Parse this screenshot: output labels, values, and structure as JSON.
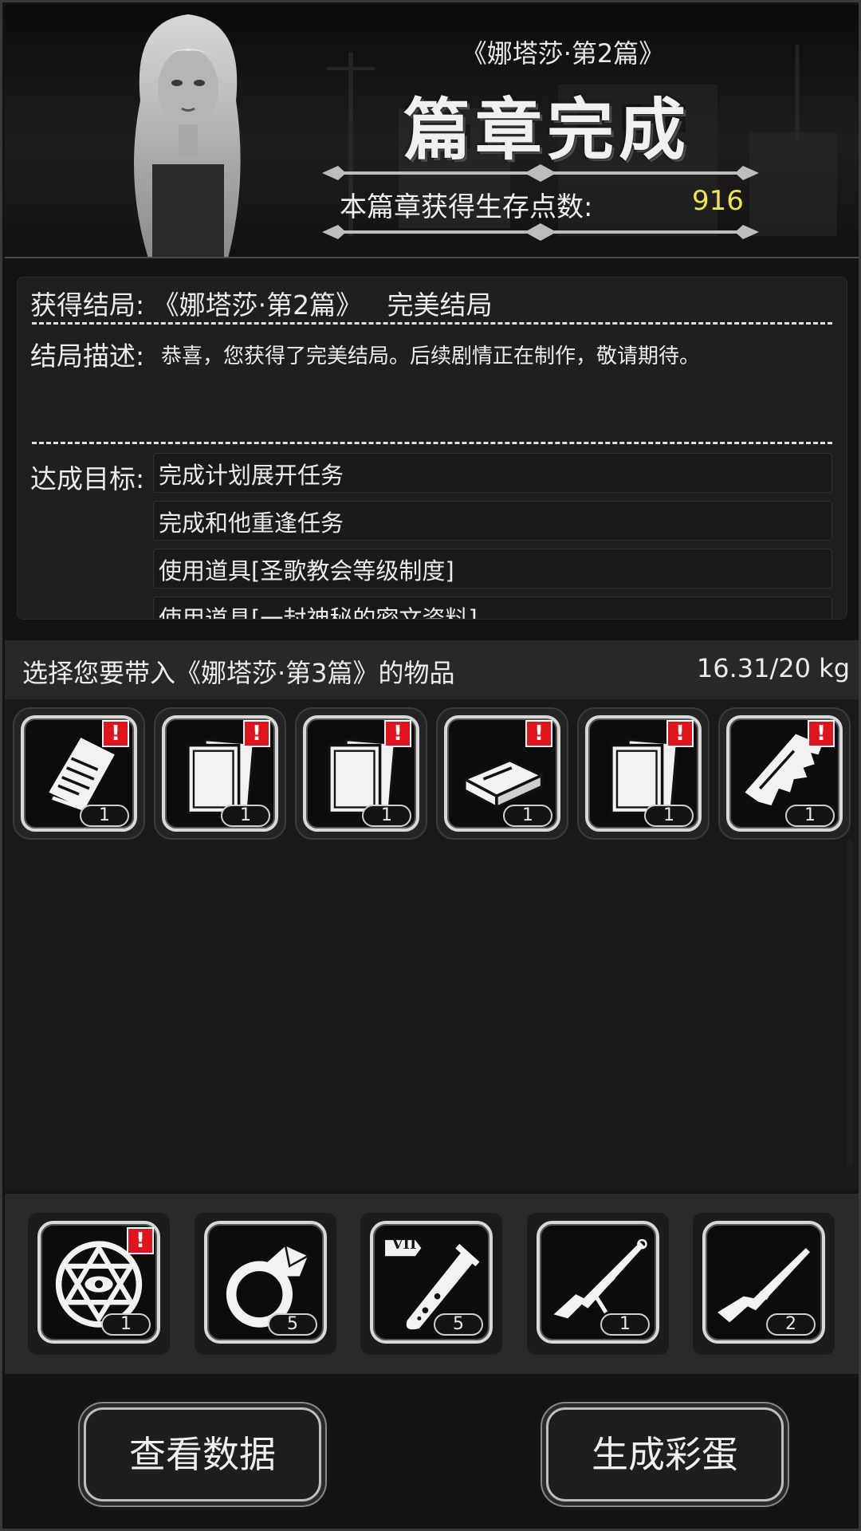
{
  "header": {
    "chapter_name": "《娜塔莎·第2篇》",
    "title": "篇章完成",
    "points_label": "本篇章获得生存点数:",
    "points_value": "916"
  },
  "ending": {
    "title_label": "获得结局:",
    "title_value": "《娜塔莎·第2篇》   完美结局",
    "desc_label": "结局描述:",
    "desc_text": "恭喜，您获得了完美结局。后续剧情正在制作，敬请期待。",
    "goals_label": "达成目标:",
    "goals": [
      "完成计划展开任务",
      "完成和他重逢任务",
      "使用道具[圣歌教会等级制度]",
      "使用道具[一封神秘的密文资料]"
    ]
  },
  "carry": {
    "label": "选择您要带入《娜塔莎·第3篇》的物品",
    "weight": "16.31/20 kg"
  },
  "items": [
    {
      "icon": "clipboard-icon",
      "alert": "!",
      "qty": "1"
    },
    {
      "icon": "papers-icon",
      "alert": "!",
      "qty": "1"
    },
    {
      "icon": "papers-icon",
      "alert": "!",
      "qty": "1"
    },
    {
      "icon": "book-icon",
      "alert": "!",
      "qty": "1"
    },
    {
      "icon": "papers-icon",
      "alert": "!",
      "qty": "1"
    },
    {
      "icon": "torn-paper-icon",
      "alert": "!",
      "qty": "1"
    }
  ],
  "equipment": [
    {
      "icon": "occult-emblem-icon",
      "alert": "!",
      "qty": "1"
    },
    {
      "icon": "ring-icon",
      "qty": "5"
    },
    {
      "icon": "test-tube-icon",
      "tag": "VII",
      "qty": "5"
    },
    {
      "icon": "sniper-rifle-icon",
      "qty": "1"
    },
    {
      "icon": "bolt-rifle-icon",
      "qty": "2"
    }
  ],
  "buttons": {
    "view_data": "查看数据",
    "generate_egg": "生成彩蛋"
  },
  "colors": {
    "points": "#f0e64a",
    "alert": "#e0141c"
  }
}
